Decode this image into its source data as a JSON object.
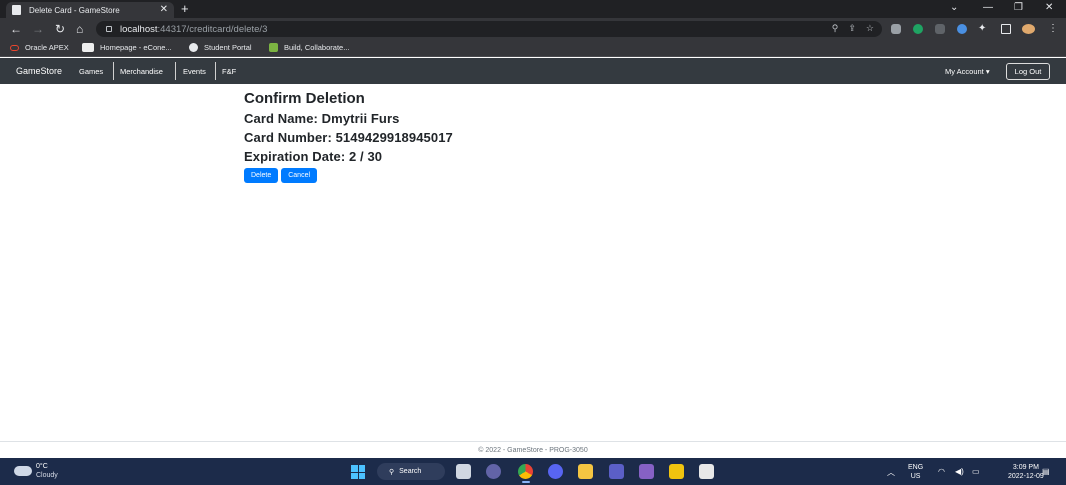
{
  "browser": {
    "tab_title": "Delete Card - GameStore",
    "url_host": "localhost",
    "url_path": ":44317/creditcard/delete/3",
    "bookmarks": [
      "Oracle APEX",
      "Homepage - eCone...",
      "Student Portal",
      "Build, Collaborate..."
    ]
  },
  "navbar": {
    "brand": "GameStore",
    "links": [
      "Games",
      "Merchandise",
      "Events",
      "F&F"
    ],
    "account": "My Account",
    "logout": "Log Out"
  },
  "page": {
    "title": "Confirm Deletion",
    "card_name_line": "Card Name: Dmytrii Furs",
    "card_number_line": "Card Number: 5149429918945017",
    "expiration_line": "Expiration Date: 2 / 30",
    "delete_label": "Delete",
    "cancel_label": "Cancel"
  },
  "footer": {
    "text": "© 2022 - GameStore - PROG-3050"
  },
  "taskbar": {
    "weather_temp": "0°C",
    "weather_desc": "Cloudy",
    "search_label": "Search",
    "lang_line1": "ENG",
    "lang_line2": "US",
    "time": "3:09 PM",
    "date": "2022-12-09"
  },
  "colors": {
    "navbar_bg": "#343a40",
    "primary_button": "#007bff",
    "taskbar_bg": "#1c2b4a"
  }
}
